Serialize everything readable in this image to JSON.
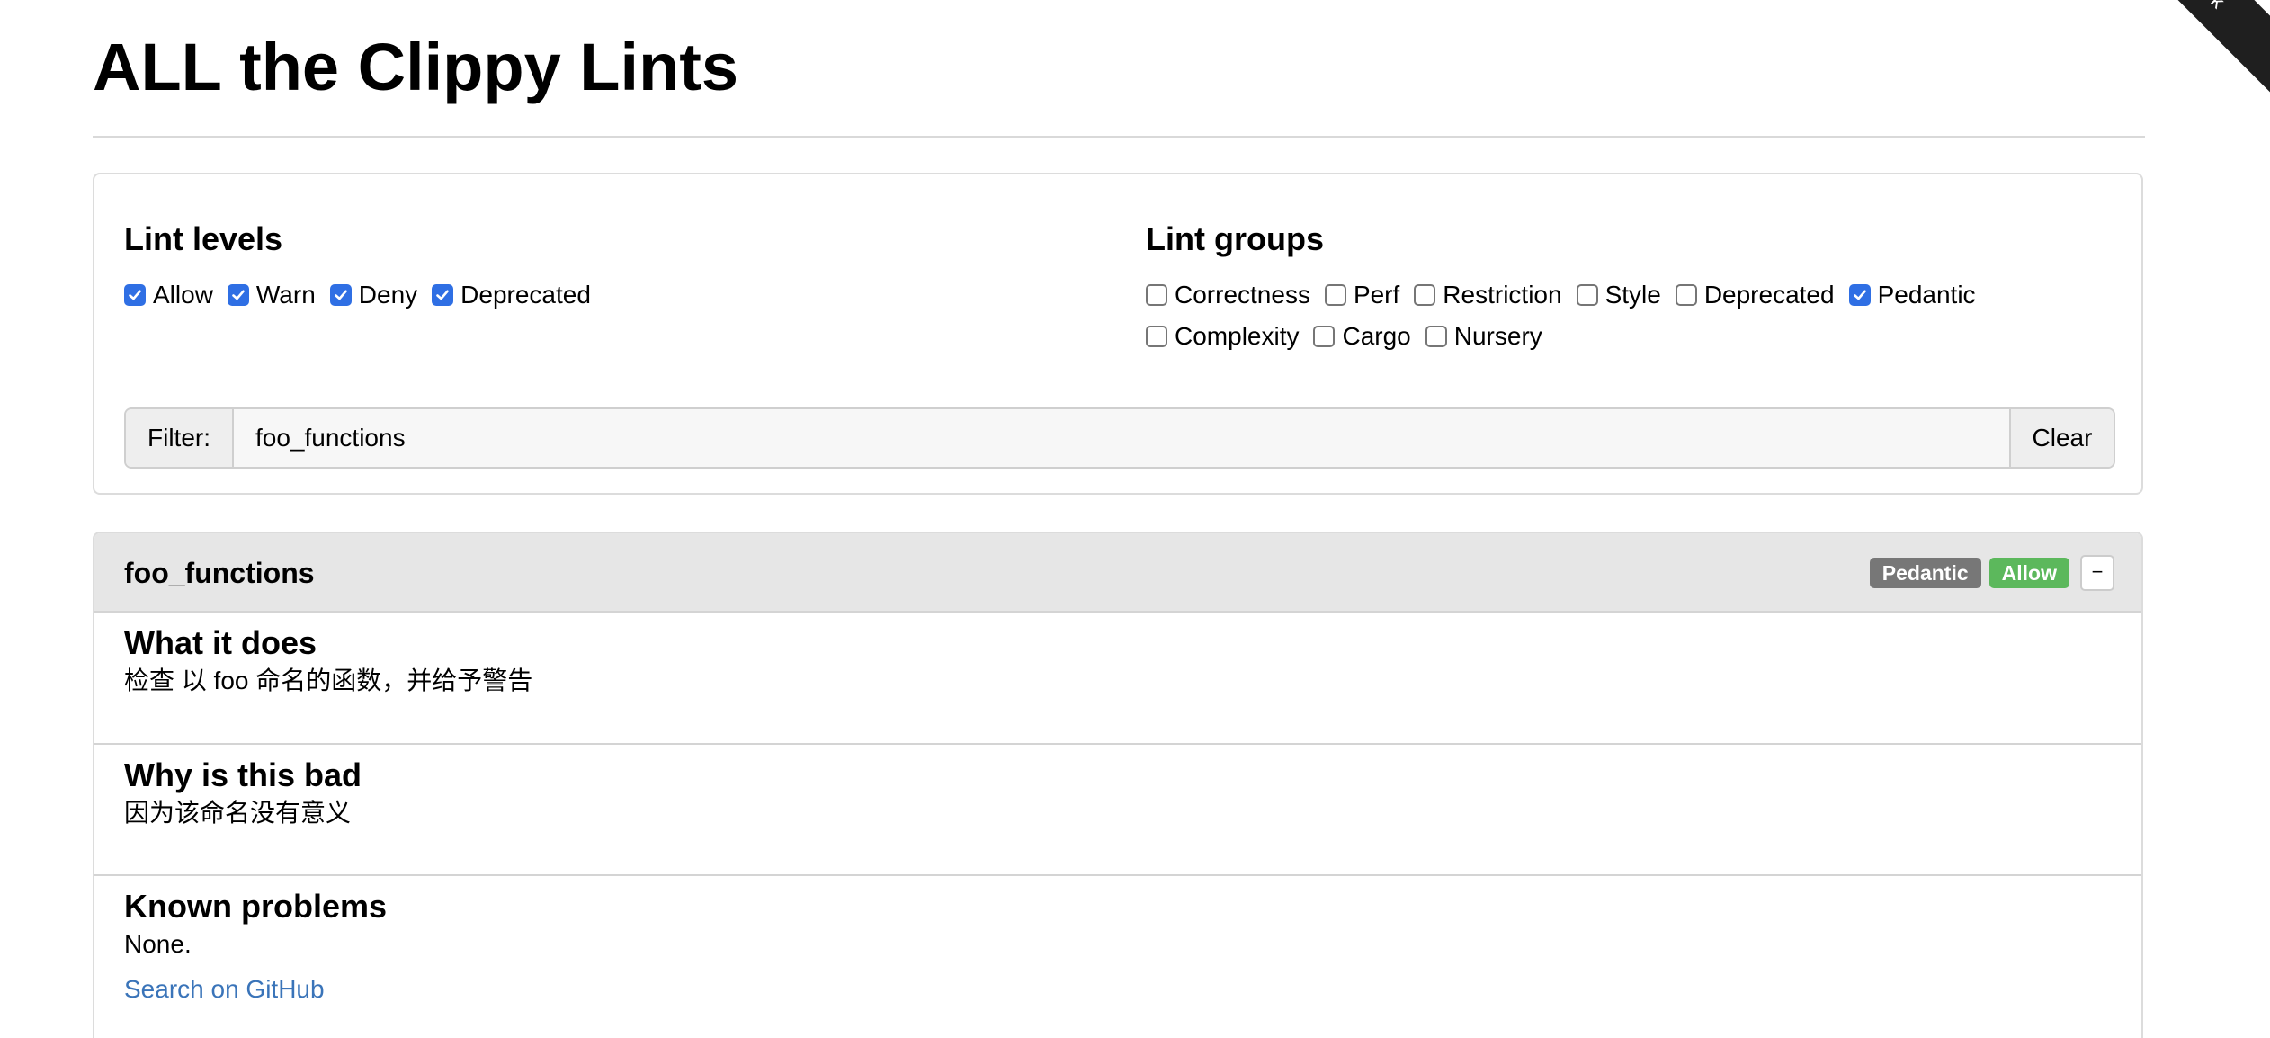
{
  "page": {
    "title": "ALL the Clippy Lints",
    "ribbon_text": "Fork"
  },
  "lint_levels": {
    "heading": "Lint levels",
    "items": [
      {
        "label": "Allow",
        "checked": true
      },
      {
        "label": "Warn",
        "checked": true
      },
      {
        "label": "Deny",
        "checked": true
      },
      {
        "label": "Deprecated",
        "checked": true
      }
    ]
  },
  "lint_groups": {
    "heading": "Lint groups",
    "row1": [
      {
        "label": "Correctness",
        "checked": false
      },
      {
        "label": "Perf",
        "checked": false
      },
      {
        "label": "Restriction",
        "checked": false
      },
      {
        "label": "Style",
        "checked": false
      },
      {
        "label": "Deprecated",
        "checked": false
      },
      {
        "label": "Pedantic",
        "checked": true
      }
    ],
    "row2": [
      {
        "label": "Complexity",
        "checked": false
      },
      {
        "label": "Cargo",
        "checked": false
      },
      {
        "label": "Nursery",
        "checked": false
      }
    ]
  },
  "filter": {
    "label": "Filter:",
    "value": "foo_functions",
    "clear_label": "Clear"
  },
  "lint": {
    "name": "foo_functions",
    "group_badge": "Pedantic",
    "level_badge": "Allow",
    "toggle_label": "−",
    "sections": [
      {
        "heading": "What it does",
        "text": "检查 以 foo 命名的函数，并给予警告"
      },
      {
        "heading": "Why is this bad",
        "text": "因为该命名没有意义"
      },
      {
        "heading": "Known problems",
        "text": "None."
      }
    ],
    "github_link": "Search on GitHub"
  },
  "colors": {
    "checkbox_checked": "#2f6fe4",
    "badge_group": "#777777",
    "badge_level": "#5cb85c",
    "link": "#3a74b9",
    "header_bg": "#e6e6e6"
  }
}
